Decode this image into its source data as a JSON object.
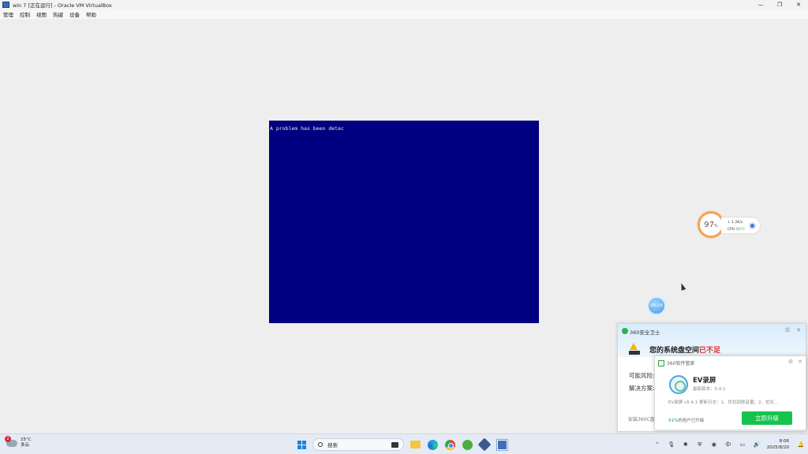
{
  "window": {
    "title": "win 7 [正在运行] - Oracle VM VirtualBox",
    "controls": {
      "minimize": "—",
      "maximize": "❐",
      "close": "✕"
    }
  },
  "menu": [
    "管理",
    "控制",
    "视图",
    "热键",
    "设备",
    "帮助"
  ],
  "guest": {
    "bsod_text": "A problem has been detec"
  },
  "float_widget": {
    "percent": "97",
    "percent_unit": "%",
    "net_speed": "1.2K/s",
    "cpu_label": "CPU",
    "cpu_temp": "65°C"
  },
  "blue_ball": {
    "label": "00:29"
  },
  "popup360": {
    "app_name": "360安全卫士",
    "headline_prefix": "您的系统盘空间",
    "headline_alert": "已不足",
    "risk_label": "可能风险:",
    "solution_label": "解决方案:",
    "footer_text": "安装360C盘",
    "colors": {
      "alert": "#e12d2d"
    }
  },
  "popup_software": {
    "source": "360软件管家",
    "app_name": "EV录屏",
    "version": "最新版本：5.4.1",
    "description": "EV录屏 v5.4.1 更新日志：1、优化回放音量；2、优化...",
    "users_pct": "91%",
    "users_text": "的用户已升级",
    "upgrade_label": "立即升级",
    "colors": {
      "button": "#16c34d"
    }
  },
  "taskbar": {
    "weather": {
      "badge": "2",
      "temp": "25°C",
      "condition": "多云"
    },
    "search_placeholder": "搜索",
    "clock": {
      "time": "8:06",
      "date": "2025/8/20"
    }
  }
}
